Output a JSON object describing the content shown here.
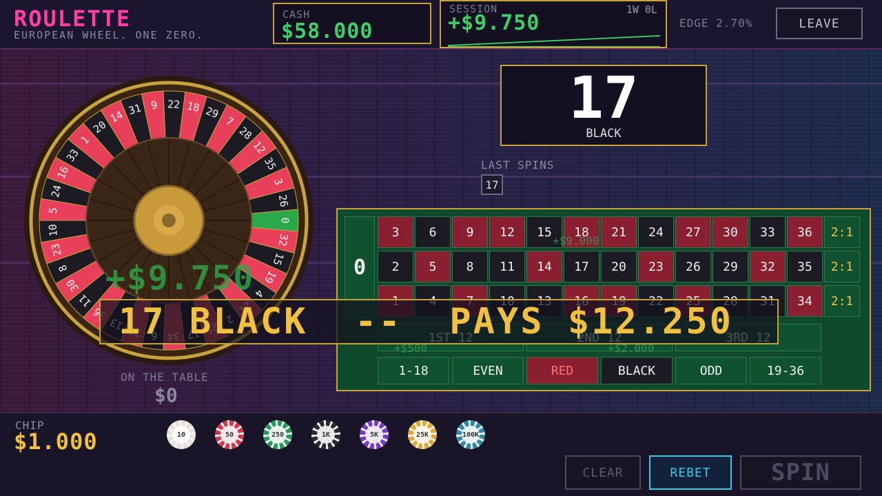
{
  "header": {
    "title": "ROULETTE",
    "subtitle": "EUROPEAN WHEEL. ONE ZERO.",
    "cash_label": "CASH",
    "cash_value": "$58.000",
    "session_label": "SESSION",
    "session_value": "+$9.750",
    "session_record": "1W 0L",
    "edge": "EDGE 2.70%",
    "leave_label": "LEAVE"
  },
  "wheel": {
    "sequence": [
      "0",
      "32",
      "15",
      "19",
      "4",
      "21",
      "2",
      "25",
      "17",
      "34",
      "6",
      "27",
      "13",
      "36",
      "11",
      "30",
      "8",
      "23",
      "10",
      "5",
      "24",
      "16",
      "33",
      "1",
      "20",
      "14",
      "31",
      "9",
      "22",
      "18",
      "29",
      "7",
      "28",
      "12",
      "35",
      "3",
      "26"
    ],
    "reds": [
      "1",
      "3",
      "5",
      "7",
      "9",
      "12",
      "14",
      "16",
      "18",
      "19",
      "21",
      "23",
      "25",
      "27",
      "30",
      "32",
      "34",
      "36"
    ],
    "floater": "+$9.750"
  },
  "result": {
    "number": "17",
    "color": "BLACK"
  },
  "last_spins": {
    "label": "LAST SPINS",
    "values": [
      "17"
    ]
  },
  "table": {
    "zero": "0",
    "rows": [
      [
        "3",
        "6",
        "9",
        "12",
        "15",
        "18",
        "21",
        "24",
        "27",
        "30",
        "33",
        "36"
      ],
      [
        "2",
        "5",
        "8",
        "11",
        "14",
        "17",
        "20",
        "23",
        "26",
        "29",
        "32",
        "35"
      ],
      [
        "1",
        "4",
        "7",
        "10",
        "13",
        "16",
        "19",
        "22",
        "25",
        "28",
        "31",
        "34"
      ]
    ],
    "column_bets": [
      "2:1",
      "2:1",
      "2:1"
    ],
    "dozens": [
      "1ST 12",
      "2ND 12",
      "3RD 12"
    ],
    "outside": [
      "1-18",
      "EVEN",
      "RED",
      "BLACK",
      "ODD",
      "19-36"
    ],
    "bet_floaters": [
      "+$9.000",
      "+$500",
      "+$2.000"
    ]
  },
  "banner": {
    "text": "17 BLACK  --  PAYS $12.250"
  },
  "on_table": {
    "label": "ON THE TABLE",
    "value": "$0"
  },
  "chip": {
    "label": "CHIP",
    "value": "$1.000",
    "options": [
      {
        "label": "10",
        "color": "#e8e0d8"
      },
      {
        "label": "50",
        "color": "#d8344a"
      },
      {
        "label": "250",
        "color": "#2a9a5a"
      },
      {
        "label": "1K",
        "color": "#2a2a34"
      },
      {
        "label": "5K",
        "color": "#7a3ac8"
      },
      {
        "label": "25K",
        "color": "#e0a830"
      },
      {
        "label": "100K",
        "color": "#2a8aa8"
      }
    ]
  },
  "controls": {
    "clear": "CLEAR",
    "rebet": "REBET",
    "spin": "SPIN"
  }
}
